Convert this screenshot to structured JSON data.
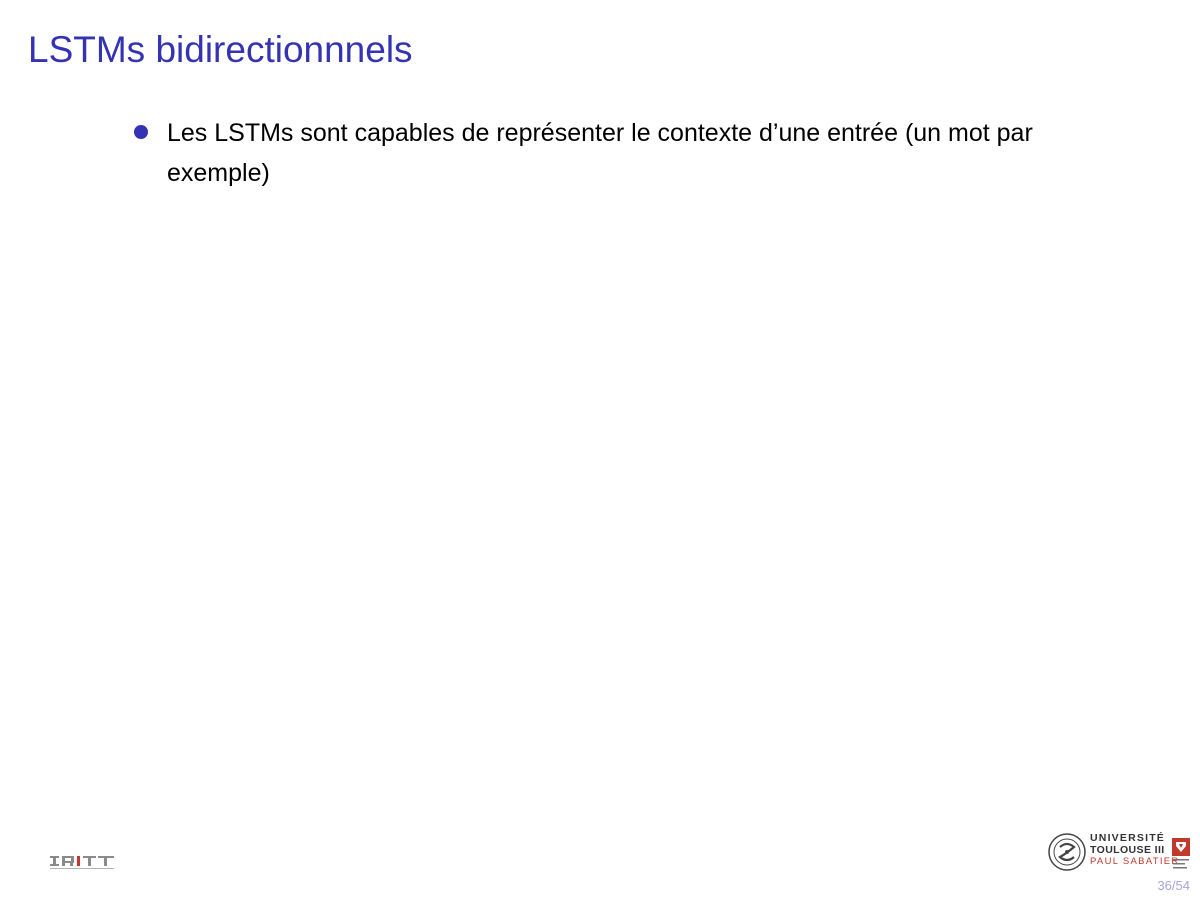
{
  "slide": {
    "title": "LSTMs bidirectionnnels",
    "bullets": [
      "Les LSTMs sont capables de représenter le contexte d’une entrée (un mot par exemple)"
    ]
  },
  "footer": {
    "left_logo": "IRIT",
    "right_logo": {
      "line1": "UNIVERSITÉ",
      "line2": "TOULOUSE III",
      "line3": "PAUL SABATIER"
    },
    "page_number": "36/54"
  },
  "colors": {
    "title": "#3333b3",
    "bullet": "#3333b3",
    "page_number": "#a6a6d9",
    "logo_red": "#c0392b"
  }
}
